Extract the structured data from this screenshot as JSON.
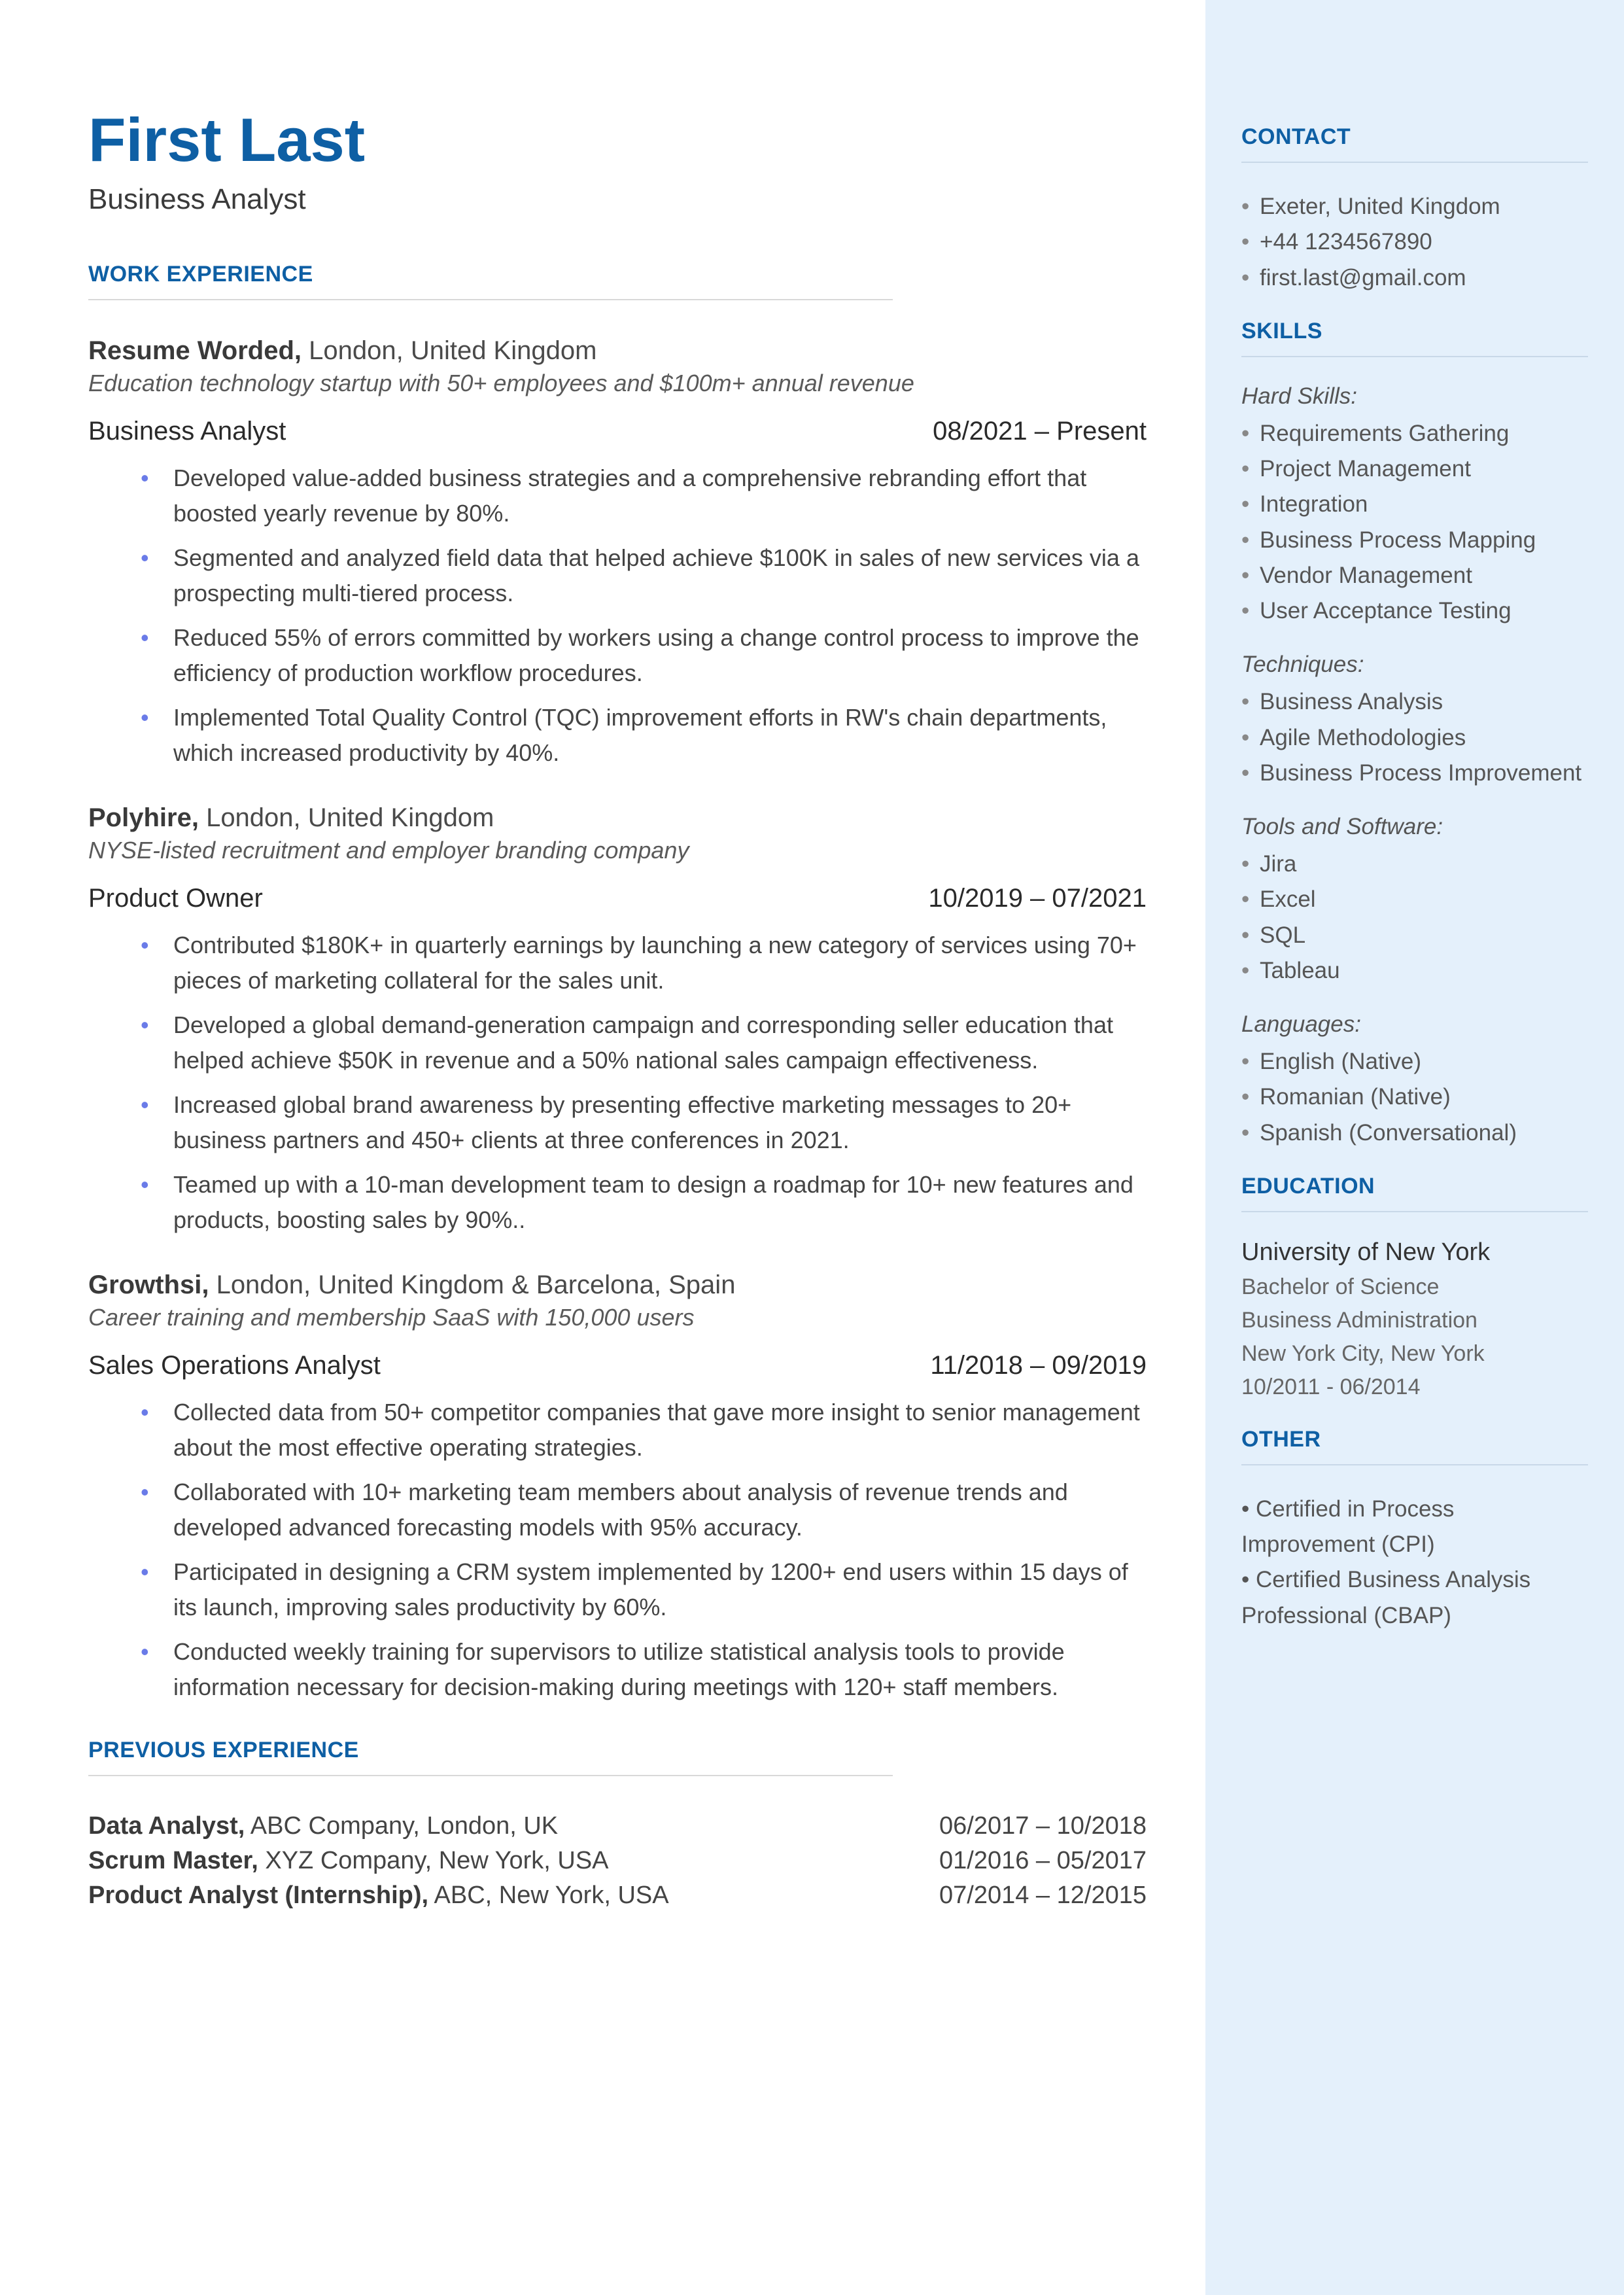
{
  "name": "First Last",
  "title": "Business Analyst",
  "sections": {
    "work": "WORK EXPERIENCE",
    "prev": "PREVIOUS EXPERIENCE",
    "contact": "CONTACT",
    "skills": "SKILLS",
    "education": "EDUCATION",
    "other": "OTHER"
  },
  "jobs": [
    {
      "company": "Resume Worded,",
      "location": " London, United Kingdom",
      "desc": "Education technology startup with 50+ employees and $100m+ annual revenue",
      "role": "Business Analyst",
      "dates": "08/2021 – Present",
      "bullets": [
        "Developed value-added business strategies and a comprehensive rebranding effort that boosted yearly revenue by 80%.",
        "Segmented and analyzed field data that helped achieve $100K in sales of new services via a prospecting multi-tiered process.",
        "Reduced 55% of errors committed by workers using a change control process to improve the efficiency of production workflow procedures.",
        "Implemented Total Quality Control (TQC) improvement efforts in RW's chain departments, which increased productivity by 40%."
      ]
    },
    {
      "company": "Polyhire,",
      "location": " London, United Kingdom",
      "desc": "NYSE-listed recruitment and employer branding company",
      "role": "Product Owner",
      "dates": "10/2019 – 07/2021",
      "bullets": [
        "Contributed $180K+ in quarterly earnings by launching a new category of services using 70+ pieces of marketing collateral for the sales unit.",
        "Developed a global demand-generation campaign and corresponding seller education that helped achieve $50K in revenue and a 50% national sales campaign effectiveness.",
        "Increased global brand awareness by presenting effective marketing messages to 20+ business partners and 450+ clients at three conferences in 2021.",
        "Teamed up with a 10-man development team to design a roadmap for 10+ new features and products, boosting sales by 90%.."
      ]
    },
    {
      "company": "Growthsi,",
      "location": " London, United Kingdom & Barcelona, Spain",
      "desc": "Career training and membership SaaS with 150,000 users",
      "role": "Sales Operations Analyst",
      "dates": "11/2018 – 09/2019",
      "bullets": [
        "Collected data from 50+ competitor companies that gave more insight to senior management about the most effective operating strategies.",
        "Collaborated with 10+ marketing team members about analysis of revenue trends and developed advanced forecasting models with 95% accuracy.",
        "Participated in designing a CRM system implemented by 1200+ end users within 15 days of its launch, improving sales productivity by 60%.",
        "Conducted weekly training for supervisors to utilize statistical analysis tools to provide information necessary for decision-making during meetings with 120+ staff members."
      ]
    }
  ],
  "previous": [
    {
      "title": "Data Analyst,",
      "rest": " ABC Company, London, UK",
      "dates": "06/2017 – 10/2018"
    },
    {
      "title": "Scrum Master,",
      "rest": " XYZ Company, New York, USA",
      "dates": "01/2016 – 05/2017"
    },
    {
      "title": "Product Analyst (Internship),",
      "rest": " ABC, New York, USA",
      "dates": "07/2014 – 12/2015"
    }
  ],
  "contact": [
    "Exeter, United Kingdom",
    "+44 1234567890",
    "first.last@gmail.com"
  ],
  "skills": {
    "hard_label": "Hard Skills:",
    "hard": [
      "Requirements Gathering",
      "Project Management",
      "Integration",
      "Business Process Mapping",
      "Vendor Management",
      "User Acceptance Testing"
    ],
    "tech_label": "Techniques:",
    "tech": [
      "Business Analysis",
      "Agile Methodologies",
      "Business Process Improvement"
    ],
    "tools_label": "Tools and Software:",
    "tools": [
      "Jira",
      "Excel",
      "SQL",
      "Tableau"
    ],
    "lang_label": "Languages:",
    "lang": [
      "English (Native)",
      "Romanian (Native)",
      "Spanish (Conversational)"
    ]
  },
  "education": {
    "school": "University of New York",
    "degree": "Bachelor of Science",
    "field": "Business Administration",
    "loc": "New York City, New York",
    "dates": "10/2011 - 06/2014"
  },
  "other": [
    "Certified in Process Improvement (CPI)",
    "Certified Business Analysis Professional (CBAP)"
  ]
}
